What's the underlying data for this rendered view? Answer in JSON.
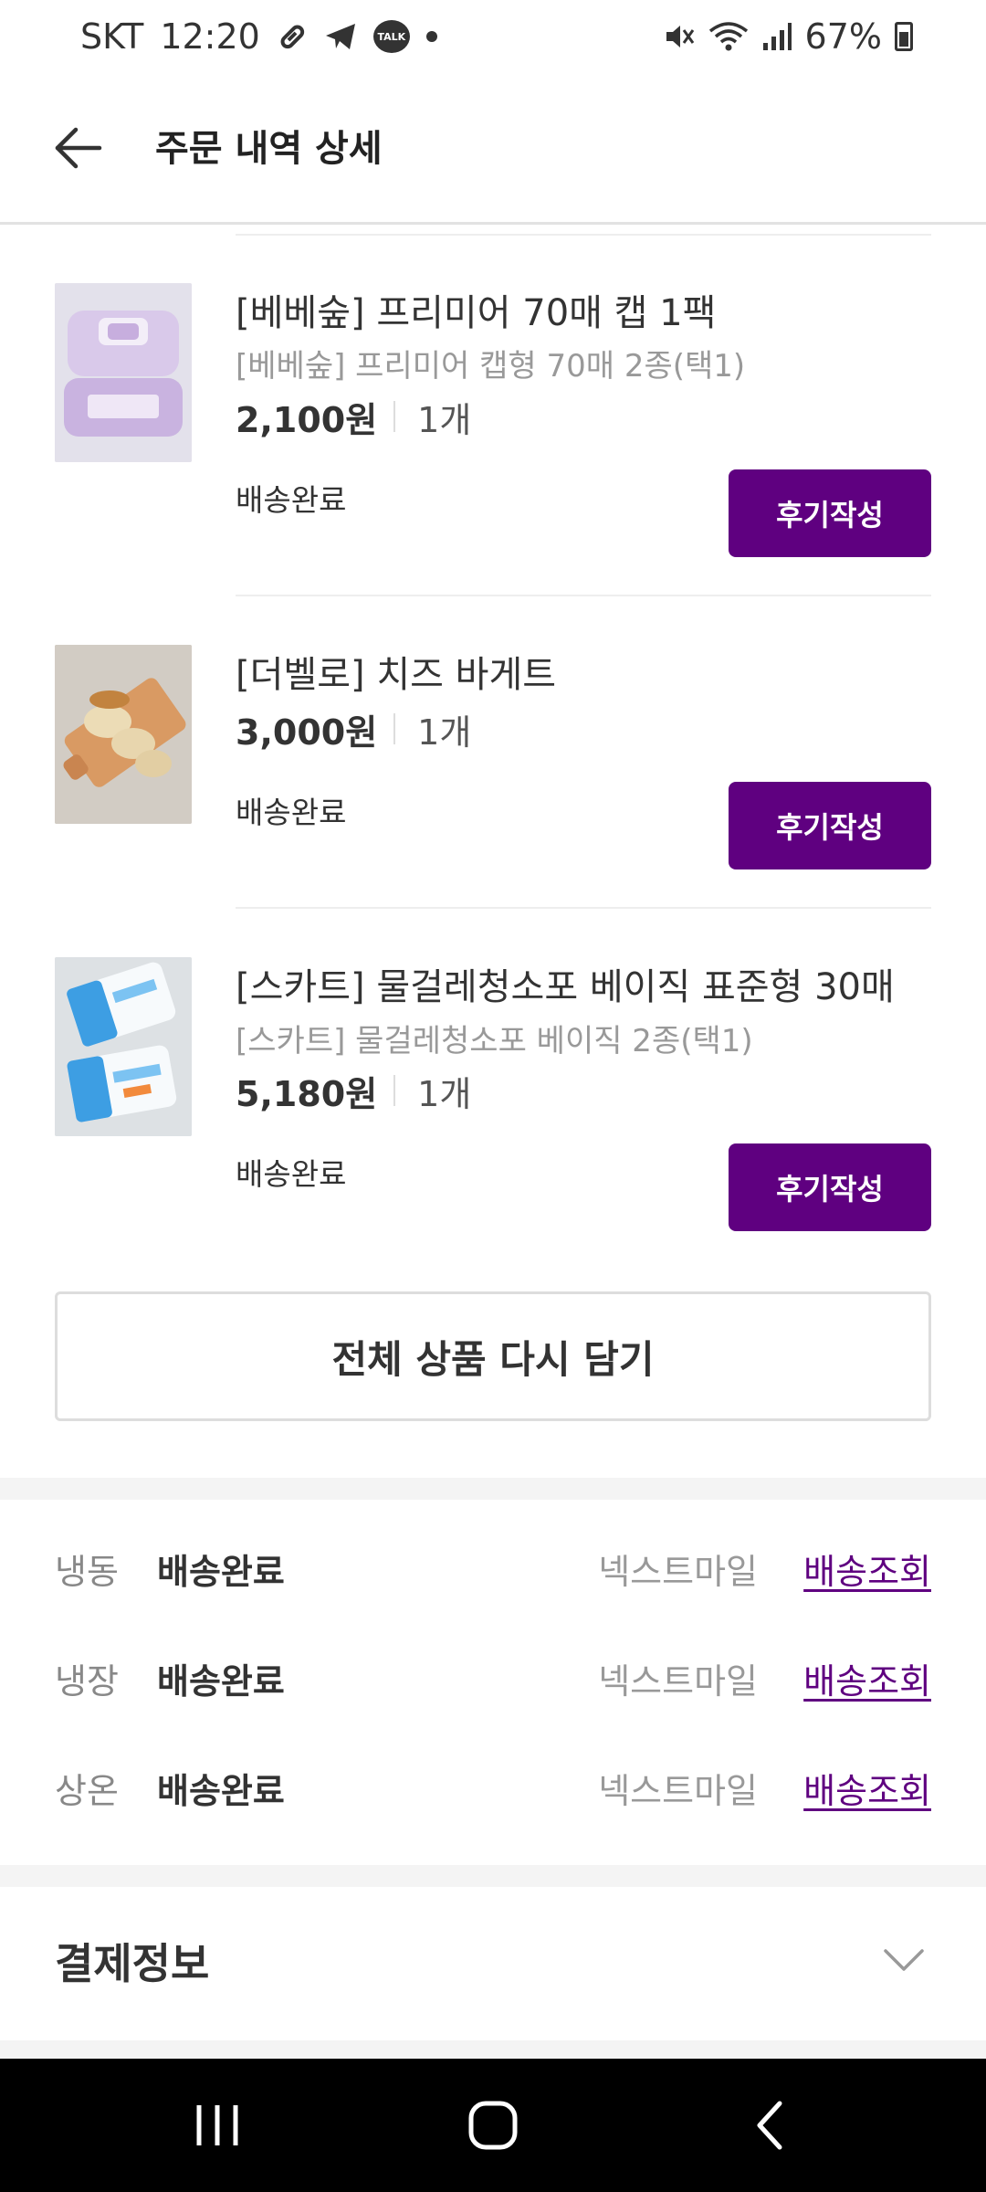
{
  "status_bar": {
    "carrier": "SKT",
    "time": "12:20",
    "talk_badge": "TALK",
    "battery": "67%",
    "icons": [
      "link-icon",
      "telegram-icon",
      "talk-icon",
      "notification-dot-icon",
      "mute-icon",
      "wifi-icon",
      "signal-icon",
      "battery-icon"
    ]
  },
  "header": {
    "title": "주문 내역 상세",
    "back_icon": "arrow-left-icon"
  },
  "products": [
    {
      "name": "[베베숲] 프리미어 70매 캡 1팩",
      "option": "[베베숲] 프리미어 캡형 70매 2종(택1)",
      "price": "2,100원",
      "qty": "1개",
      "status": "배송완료",
      "button": "후기작성"
    },
    {
      "name": "[더벨로] 치즈 바게트",
      "option": "",
      "price": "3,000원",
      "qty": "1개",
      "status": "배송완료",
      "button": "후기작성"
    },
    {
      "name": "[스카트] 물걸레청소포 베이직 표준형 30매",
      "option": "[스카트] 물걸레청소포 베이직 2종(택1)",
      "price": "5,180원",
      "qty": "1개",
      "status": "배송완료",
      "button": "후기작성"
    }
  ],
  "reorder_button": "전체 상품 다시 담기",
  "deliveries": [
    {
      "type": "냉동",
      "status": "배송완료",
      "courier": "넥스트마일",
      "link": "배송조회"
    },
    {
      "type": "냉장",
      "status": "배송완료",
      "courier": "넥스트마일",
      "link": "배송조회"
    },
    {
      "type": "상온",
      "status": "배송완료",
      "courier": "넥스트마일",
      "link": "배송조회"
    }
  ],
  "payment": {
    "title": "결제정보",
    "expand_icon": "chevron-down-icon"
  },
  "nav_bar": {
    "icons": [
      "recent-apps-icon",
      "home-icon",
      "back-icon"
    ]
  },
  "colors": {
    "accent": "#5f0080",
    "text": "#333333",
    "muted": "#999999",
    "divider": "#eeeeee",
    "band": "#f4f4f4"
  }
}
